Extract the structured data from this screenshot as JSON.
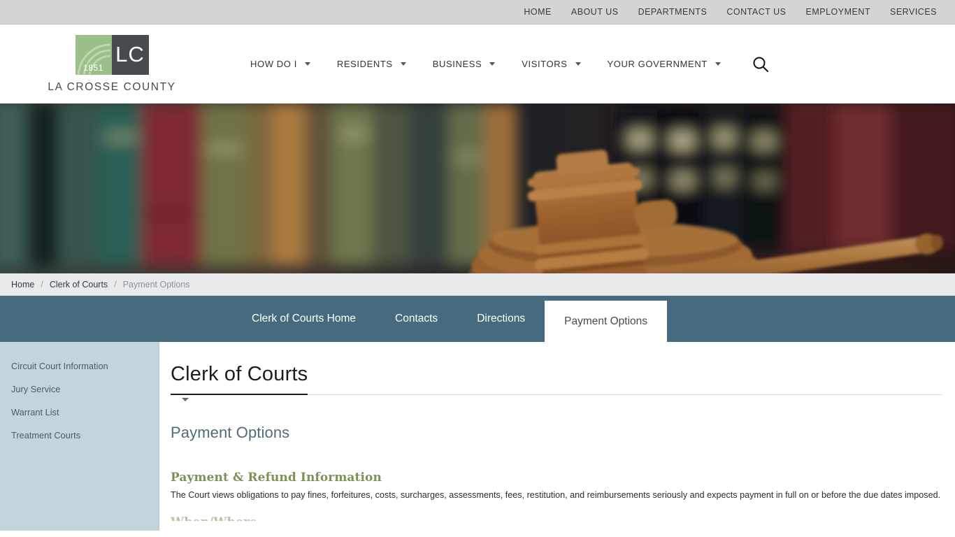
{
  "topbar": {
    "links": [
      {
        "label": "HOME"
      },
      {
        "label": "ABOUT US"
      },
      {
        "label": "DEPARTMENTS"
      },
      {
        "label": "CONTACT US"
      },
      {
        "label": "EMPLOYMENT"
      },
      {
        "label": "SERVICES"
      }
    ]
  },
  "logo": {
    "year": "1851",
    "initials": "LC",
    "name": "LA CROSSE COUNTY"
  },
  "mainnav": {
    "items": [
      {
        "label": "HOW DO I",
        "has_caret": true
      },
      {
        "label": "RESIDENTS",
        "has_caret": true
      },
      {
        "label": "BUSINESS",
        "has_caret": true
      },
      {
        "label": "VISITORS",
        "has_caret": true
      },
      {
        "label": "YOUR GOVERNMENT",
        "has_caret": true
      }
    ],
    "search_icon": "search-icon"
  },
  "hero": {
    "alt": "Blurred courtroom gavel resting on sound block in front of law book shelves"
  },
  "breadcrumb": {
    "items": [
      {
        "label": "Home",
        "current": false
      },
      {
        "label": "Clerk of Courts",
        "current": false
      },
      {
        "label": "Payment Options",
        "current": true
      }
    ],
    "separator": "/"
  },
  "tabs": [
    {
      "label": "Clerk of Courts Home",
      "active": false
    },
    {
      "label": "Contacts",
      "active": false
    },
    {
      "label": "Directions",
      "active": false
    },
    {
      "label": "Payment Options",
      "active": true
    }
  ],
  "sidebar": {
    "items": [
      {
        "label": "Circuit Court Information"
      },
      {
        "label": "Jury Service"
      },
      {
        "label": "Warrant List"
      },
      {
        "label": "Treatment Courts"
      }
    ]
  },
  "main": {
    "page_title": "Clerk of Courts",
    "sub_title": "Payment Options",
    "section_heading": "Payment & Refund Information",
    "paragraph": "The Court views obligations to pay fines, forfeitures, costs, surcharges, assessments, fees, restitution, and reimbursements seriously and expects payment in full on or before the due dates imposed.",
    "next_heading_partial": "When/Where"
  },
  "colors": {
    "topbar_bg": "#d4d4d4",
    "tabbar_teal": "#466a7e",
    "sidebar_bg": "#c2d5df",
    "breadcrumb_bg": "#e8eaeb",
    "subtitle_slate": "#4f6b7c",
    "heading_green": "#7c9157",
    "logo_green": "#9cbf8a",
    "logo_dark": "#474b4d"
  }
}
